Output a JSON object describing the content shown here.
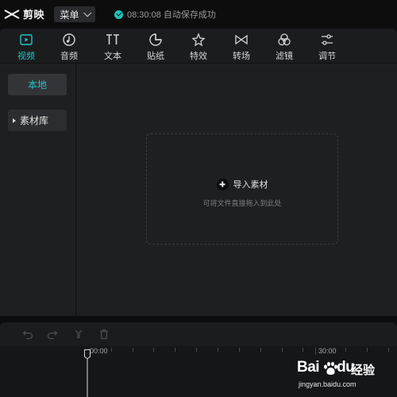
{
  "app": {
    "name": "剪映",
    "menu_label": "菜单",
    "save_status": "08:30:08 自动保存成功"
  },
  "toolbar": {
    "items": [
      {
        "label": "视频",
        "icon": "video-icon",
        "active": true
      },
      {
        "label": "音频",
        "icon": "audio-icon",
        "active": false
      },
      {
        "label": "文本",
        "icon": "text-icon",
        "active": false
      },
      {
        "label": "贴纸",
        "icon": "sticker-icon",
        "active": false
      },
      {
        "label": "特效",
        "icon": "effects-icon",
        "active": false
      },
      {
        "label": "转场",
        "icon": "transition-icon",
        "active": false
      },
      {
        "label": "滤镜",
        "icon": "filter-icon",
        "active": false
      },
      {
        "label": "调节",
        "icon": "adjust-icon",
        "active": false
      }
    ]
  },
  "sidebar": {
    "local_label": "本地",
    "library_label": "素材库"
  },
  "dropzone": {
    "import_label": "导入素材",
    "hint": "可将文件直接拖入到此处"
  },
  "timeline": {
    "start_time": "00:00",
    "mark_time": "30:00"
  },
  "watermark": {
    "logo": "Bai",
    "logo_tail": "du",
    "suffix": "经验",
    "url": "jingyan.baidu.com"
  },
  "colors": {
    "accent": "#22c6c6",
    "background": "#0d0d0e",
    "panel": "#1e1f21"
  }
}
